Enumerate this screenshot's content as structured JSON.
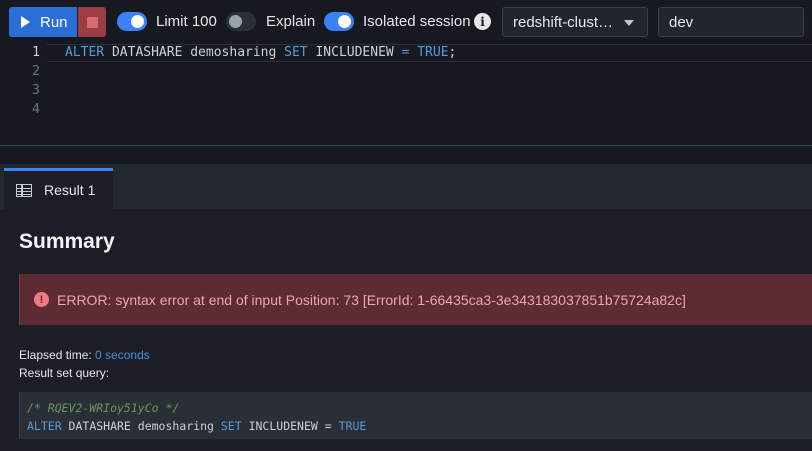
{
  "toolbar": {
    "run_label": "Run",
    "limit_label": "Limit 100",
    "explain_label": "Explain",
    "isolated_label": "Isolated session",
    "cluster_select": "redshift-clust…",
    "database_select": "dev"
  },
  "editor": {
    "line_numbers": [
      "1",
      "2",
      "3",
      "4"
    ],
    "line1": {
      "kw1": "ALTER",
      "t1": " DATASHARE demosharing ",
      "kw2": "SET",
      "t2": " INCLUDENEW ",
      "kw3": "=",
      "t3": " ",
      "kw4": "TRUE",
      "t4": ";"
    }
  },
  "results": {
    "tab_label": "Result 1",
    "summary_title": "Summary",
    "error_message": "ERROR: syntax error at end of input Position: 73 [ErrorId: 1-66435ca3-3e343183037851b75724a82c]",
    "elapsed_label": "Elapsed time: ",
    "elapsed_value": "0 seconds",
    "result_query_label": "Result set query:",
    "query_comment": "/* RQEV2-WRIoy51yCo */",
    "query": {
      "kw1": "ALTER",
      "t1": " DATASHARE demosharing ",
      "kw2": "SET",
      "t2": " INCLUDENEW = ",
      "kw3": "TRUE"
    }
  },
  "colors": {
    "accent": "#3b82f6",
    "error_bg": "#5c2b33",
    "error_text": "#f0a4ab",
    "keyword": "#569cd6"
  }
}
